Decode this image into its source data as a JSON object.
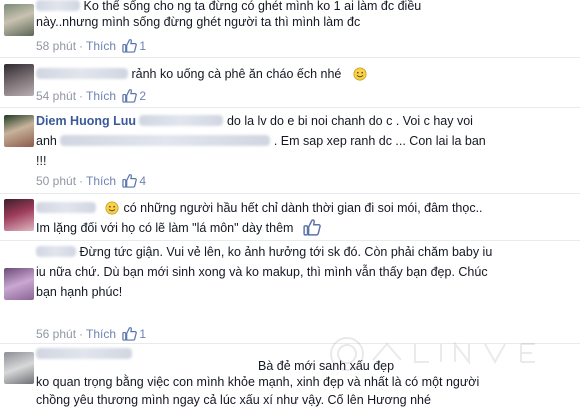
{
  "comments": [
    {
      "lines": [
        "Ko thể sống cho ng ta đừng có ghét mình ko 1 ai làm đc điều",
        "này..nhưng mình sống đừng ghét người ta thì mình làm đc"
      ],
      "time": "58 phút",
      "like_label": "Thích",
      "likes": "1"
    },
    {
      "lines": [
        "rảnh ko uống cà phê ăn cháo ếch nhé"
      ],
      "time": "54 phút",
      "like_label": "Thích",
      "likes": "2"
    },
    {
      "name": "Diem Huong Luu",
      "lines": [
        "do la lv do e bi noi chanh do c . Voi c hay voi",
        "anh",
        ". Em sap xep ranh dc ... Con lai la ban",
        "!!!"
      ],
      "time": "50 phút",
      "like_label": "Thích",
      "likes": "4"
    },
    {
      "lines": [
        "có những người hầu hết chỉ dành thời gian đi soi mói, đâm thọc..",
        "Im lặng đối với họ có lẽ làm \"lá môn\" dày thêm"
      ]
    },
    {
      "lines": [
        "Đừng tức giận. Vui vẻ lên, ko ảnh hưởng tới sk đó. Còn phải chăm baby iu",
        "iu nữa chứ. Dù bạn mới sinh xong và ko makup, thì mình vẫn thấy bạn đẹp. Chúc",
        "bạn hạnh phúc!"
      ],
      "time": "56 phút",
      "like_label": "Thích",
      "likes": "1"
    },
    {
      "lines": [
        "Bà đẻ mới sanh xấu đẹp",
        "ko quan trọng bằng việc con mình khỏe mạnh, xinh đẹp và nhất là có một người",
        "chồng yêu thương mình ngay cả lúc xấu xí như vậy. Cố lên Hương nhé"
      ]
    }
  ]
}
